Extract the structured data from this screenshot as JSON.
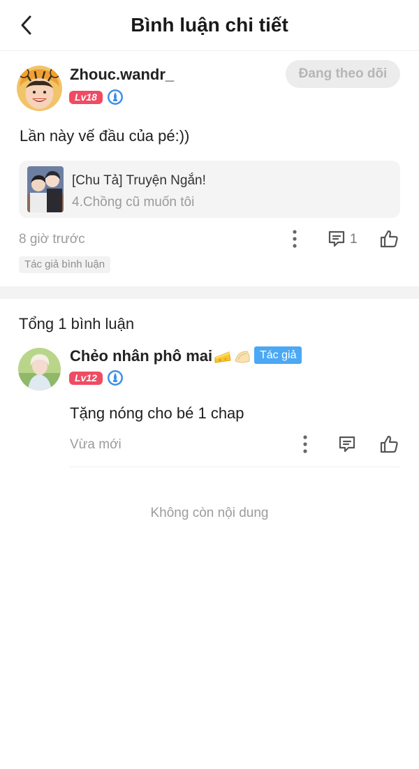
{
  "header": {
    "title": "Bình luận chi tiết"
  },
  "post": {
    "author": {
      "name": "Zhouc.wandr_",
      "level": "Lv18"
    },
    "follow_label": "Đang theo dõi",
    "text": "Lần này vế đầu của pé:))",
    "comic": {
      "title": "[Chu Tả] Truyện Ngắn!",
      "chapter": "4.Chồng cũ muốn tôi"
    },
    "time": "8 giờ trước",
    "reply_count": "1",
    "author_tag": "Tác giả bình luận"
  },
  "comments": {
    "total_label": "Tổng 1 bình luận",
    "items": [
      {
        "author_name": "Chẻo nhân phô mai",
        "level": "Lv12",
        "author_chip": "Tác giả",
        "text": "Tặng nóng cho bé 1 chap",
        "time": "Vừa mới"
      }
    ]
  },
  "end_label": "Không còn nội dung",
  "colors": {
    "level_badge": "#ef4b63",
    "author_chip": "#4aa8f5",
    "follow_bg": "#ececec",
    "muted_text": "#9b9b9b"
  },
  "icons": [
    "back-chevron-icon",
    "gem-badge-icon",
    "more-dots-icon",
    "comment-icon",
    "thumbs-up-icon",
    "cheese-emoji",
    "dumpling-emoji"
  ]
}
